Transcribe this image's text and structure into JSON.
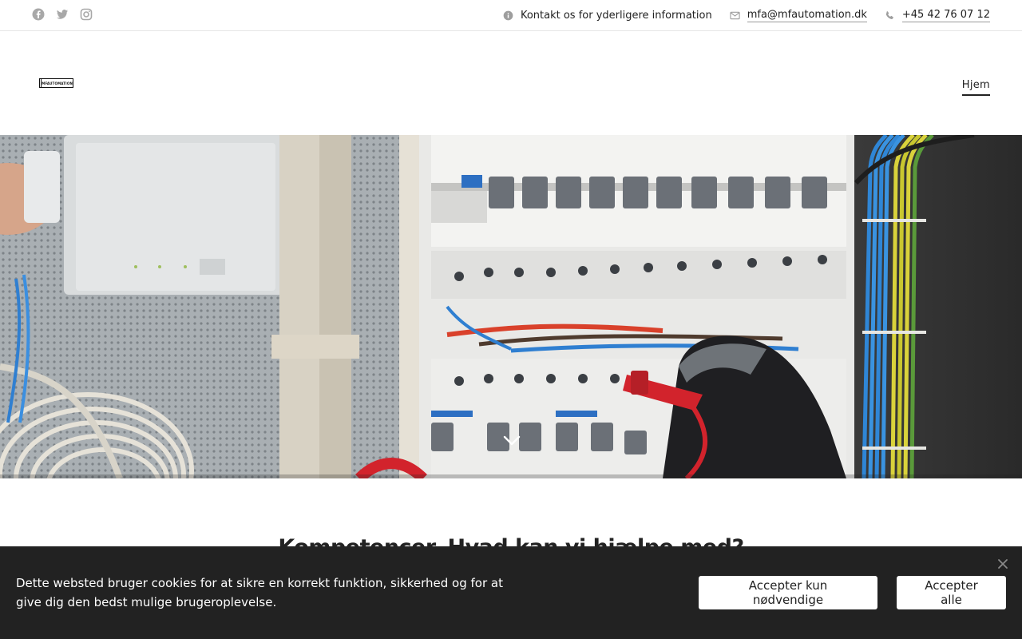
{
  "topbar": {
    "social_icons": [
      "facebook-icon",
      "twitter-icon",
      "instagram-icon"
    ],
    "info_text": "Kontakt os for yderligere information",
    "email": "mfa@mfautomation.dk",
    "phone": "+45 42 76 07 12"
  },
  "header": {
    "logo_text": "MFAUTOMATION",
    "nav": [
      {
        "label": "Hjem",
        "active": true
      }
    ]
  },
  "hero": {
    "image": "electrical-panel-photo",
    "scroll_icon": "chevron-down-icon"
  },
  "content": {
    "section_title": "Kompetencer. Hvad kan vi hjælpe med?"
  },
  "cookie": {
    "message": "Dette websted bruger cookies for at sikre en korrekt funktion, sikkerhed og for at give dig den bedst mulige brugeroplevelse.",
    "btn_necessary": "Accepter kun nødvendige",
    "btn_all": "Accepter alle",
    "close_icon": "close-icon"
  },
  "colors": {
    "text": "#222222",
    "icon_gray": "#9e9e9e",
    "banner_bg": "#222222",
    "divider": "#e6e6e6"
  }
}
